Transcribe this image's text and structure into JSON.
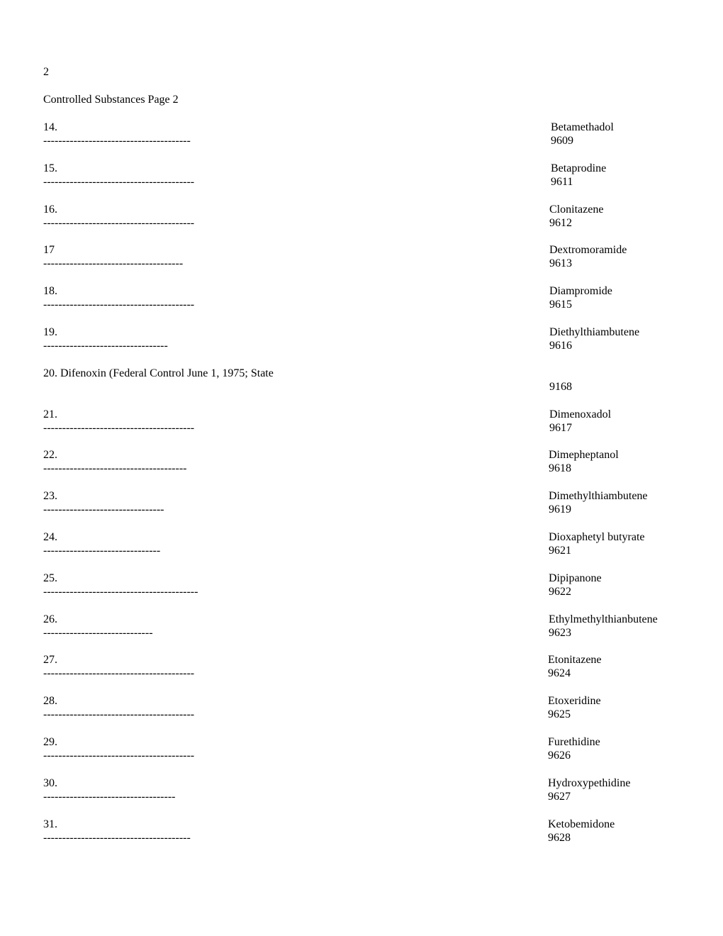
{
  "page_number": "2",
  "page_title": "Controlled Substances Page 2",
  "entries": [
    {
      "num": "14.",
      "dashes": 39,
      "name": "Betamethadol",
      "code": "9609"
    },
    {
      "num": "15.",
      "dashes": 40,
      "name": "Betaprodine",
      "code": "9611"
    },
    {
      "num": "16.",
      "dashes": 40,
      "name": "Clonitazene",
      "code": "9612"
    },
    {
      "num": "17",
      "dashes": 37,
      "name": "Dextromoramide",
      "code": "9613"
    },
    {
      "num": "18.",
      "dashes": 40,
      "name": "Diampromide",
      "code": "9615"
    },
    {
      "num": "19.",
      "dashes": 33,
      "name": "Diethylthiambutene",
      "code": "9616"
    },
    {
      "num": "20. Difenoxin (Federal Control June 1, 1975; State",
      "dashes": 0,
      "name": "",
      "code": "9168"
    },
    {
      "num": "21.",
      "dashes": 40,
      "name": "Dimenoxadol",
      "code": "9617"
    },
    {
      "num": "22.",
      "dashes": 38,
      "name": "Dimepheptanol",
      "code": "9618"
    },
    {
      "num": "23.",
      "dashes": 32,
      "name": "Dimethylthiambutene",
      "code": "9619"
    },
    {
      "num": "24.",
      "dashes": 31,
      "name": "Dioxaphetyl butyrate",
      "code": "9621"
    },
    {
      "num": "25.",
      "dashes": 41,
      "name": "Dipipanone",
      "code": "9622"
    },
    {
      "num": "26.",
      "dashes": 29,
      "name": "Ethylmethylthianbutene",
      "code": "9623"
    },
    {
      "num": "27.",
      "dashes": 40,
      "name": "Etonitazene",
      "code": "9624"
    },
    {
      "num": "28.",
      "dashes": 40,
      "name": "Etoxeridine",
      "code": "9625"
    },
    {
      "num": "29.",
      "dashes": 40,
      "name": "Furethidine",
      "code": "9626"
    },
    {
      "num": "30.",
      "dashes": 35,
      "name": "Hydroxypethidine",
      "code": "9627"
    },
    {
      "num": "31.",
      "dashes": 39,
      "name": "Ketobemidone",
      "code": "9628"
    }
  ]
}
